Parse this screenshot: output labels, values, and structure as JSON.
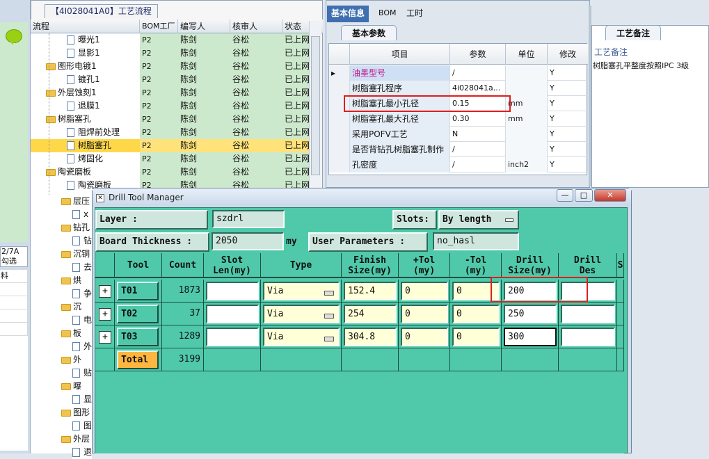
{
  "process_panel": {
    "title": "【4I028041A0】工艺流程",
    "headers": [
      "流程",
      "BOM工厂",
      "编写人",
      "核审人",
      "状态"
    ],
    "rows": [
      {
        "name": "曝光1",
        "type": "doc",
        "indent": 2,
        "bom": "P2",
        "author": "陈剑",
        "reviewer": "谷松",
        "status": "已上网",
        "selected": false
      },
      {
        "name": "显影1",
        "type": "doc",
        "indent": 2,
        "bom": "P2",
        "author": "陈剑",
        "reviewer": "谷松",
        "status": "已上网",
        "selected": false
      },
      {
        "name": "图形电镀1",
        "type": "folder",
        "indent": 1,
        "bom": "P2",
        "author": "陈剑",
        "reviewer": "谷松",
        "status": "已上网",
        "selected": false
      },
      {
        "name": "镀孔1",
        "type": "doc",
        "indent": 2,
        "bom": "P2",
        "author": "陈剑",
        "reviewer": "谷松",
        "status": "已上网",
        "selected": false
      },
      {
        "name": "外层蚀刻1",
        "type": "folder",
        "indent": 1,
        "bom": "P2",
        "author": "陈剑",
        "reviewer": "谷松",
        "status": "已上网",
        "selected": false
      },
      {
        "name": "退膜1",
        "type": "doc",
        "indent": 2,
        "bom": "P2",
        "author": "陈剑",
        "reviewer": "谷松",
        "status": "已上网",
        "selected": false
      },
      {
        "name": "树脂塞孔",
        "type": "folder",
        "indent": 1,
        "bom": "P2",
        "author": "陈剑",
        "reviewer": "谷松",
        "status": "已上网",
        "selected": false
      },
      {
        "name": "阻焊前处理",
        "type": "doc",
        "indent": 2,
        "bom": "P2",
        "author": "陈剑",
        "reviewer": "谷松",
        "status": "已上网",
        "selected": false
      },
      {
        "name": "树脂塞孔",
        "type": "doc",
        "indent": 2,
        "bom": "P2",
        "author": "陈剑",
        "reviewer": "谷松",
        "status": "已上网",
        "selected": true
      },
      {
        "name": "烤固化",
        "type": "doc",
        "indent": 2,
        "bom": "P2",
        "author": "陈剑",
        "reviewer": "谷松",
        "status": "已上网",
        "selected": false
      },
      {
        "name": "陶瓷磨板",
        "type": "folder",
        "indent": 1,
        "bom": "P2",
        "author": "陈剑",
        "reviewer": "谷松",
        "status": "已上网",
        "selected": false
      },
      {
        "name": "陶瓷磨板",
        "type": "doc",
        "indent": 2,
        "bom": "P2",
        "author": "陈剑",
        "reviewer": "谷松",
        "status": "已上网",
        "selected": false
      }
    ],
    "tree_visible_under_window": [
      "层压",
      "x",
      "钻孔",
      "钻",
      "沉铜",
      "去",
      "烘",
      "争",
      "沉",
      "电镀",
      "板",
      "外层",
      "外",
      "贴",
      "曝",
      "显",
      "图形",
      "图",
      "外层",
      "退"
    ]
  },
  "left_strip": {
    "text1": "2/7A",
    "text2": "勾选",
    "text3": "料"
  },
  "info_panel": {
    "tabs": [
      "基本信息",
      "BOM",
      "工时"
    ],
    "subtab": "基本参数",
    "headers": [
      "项目",
      "参数",
      "单位",
      "修改"
    ],
    "rows": [
      {
        "marker": "▸",
        "item": "油墨型号",
        "value": "/",
        "unit": "",
        "modified": "Y",
        "highlight": true
      },
      {
        "marker": "",
        "item": "树脂塞孔程序",
        "value": "4i028041a...",
        "unit": "",
        "modified": "Y",
        "highlight": false
      },
      {
        "marker": "",
        "item": "树脂塞孔最小孔径",
        "value": "0.15",
        "unit": "mm",
        "modified": "Y",
        "highlight": false
      },
      {
        "marker": "",
        "item": "树脂塞孔最大孔径",
        "value": "0.30",
        "unit": "mm",
        "modified": "Y",
        "highlight": false
      },
      {
        "marker": "",
        "item": "采用POFV工艺",
        "value": "N",
        "unit": "",
        "modified": "Y",
        "highlight": false
      },
      {
        "marker": "",
        "item": "是否背钻孔树脂塞孔制作",
        "value": "/",
        "unit": "",
        "modified": "Y",
        "highlight": false
      },
      {
        "marker": "",
        "item": "孔密度",
        "value": "/",
        "unit": "inch2",
        "modified": "Y",
        "highlight": false
      }
    ]
  },
  "remark_panel": {
    "tab": "工艺备注",
    "label": "工艺备注",
    "text": "树脂塞孔平整度按照IPC 3级"
  },
  "drill_tool_manager": {
    "title": "Drill Tool Manager",
    "layer_label": "Layer          :",
    "layer_value": "szdrl",
    "slots_label": "Slots:",
    "slots_value": "By length",
    "thickness_label": "Board Thickness :",
    "thickness_value": "2050",
    "thickness_unit": "my",
    "user_params_label": "User Parameters :",
    "user_params_value": "no_hasl",
    "columns": [
      {
        "l1": "",
        "l2": ""
      },
      {
        "l1": "Tool",
        "l2": ""
      },
      {
        "l1": "Count",
        "l2": ""
      },
      {
        "l1": "Slot",
        "l2": "Len(my)"
      },
      {
        "l1": "Type",
        "l2": ""
      },
      {
        "l1": "Finish",
        "l2": "Size(my)"
      },
      {
        "l1": "+Tol",
        "l2": "(my)"
      },
      {
        "l1": "-Tol",
        "l2": "(my)"
      },
      {
        "l1": "Drill",
        "l2": "Size(my)"
      },
      {
        "l1": "Drill",
        "l2": "Des"
      },
      {
        "l1": "S",
        "l2": ""
      }
    ],
    "tools": [
      {
        "tool": "T01",
        "count": "1873",
        "slot_len": "",
        "type": "Via",
        "finish": "152.4",
        "plus_tol": "0",
        "minus_tol": "0",
        "drill_size": "200",
        "drill_des": ""
      },
      {
        "tool": "T02",
        "count": "37",
        "slot_len": "",
        "type": "Via",
        "finish": "254",
        "plus_tol": "0",
        "minus_tol": "0",
        "drill_size": "250",
        "drill_des": ""
      },
      {
        "tool": "T03",
        "count": "1289",
        "slot_len": "",
        "type": "Via",
        "finish": "304.8",
        "plus_tol": "0",
        "minus_tol": "0",
        "drill_size": "300",
        "drill_des": ""
      }
    ],
    "total_label": "Total",
    "total_count": "3199"
  },
  "colors": {
    "dtm_bg": "#4fc9aa",
    "selection": "#ffd84a",
    "highlight_red": "#e01d1d",
    "tab_active": "#3f6fb0"
  }
}
